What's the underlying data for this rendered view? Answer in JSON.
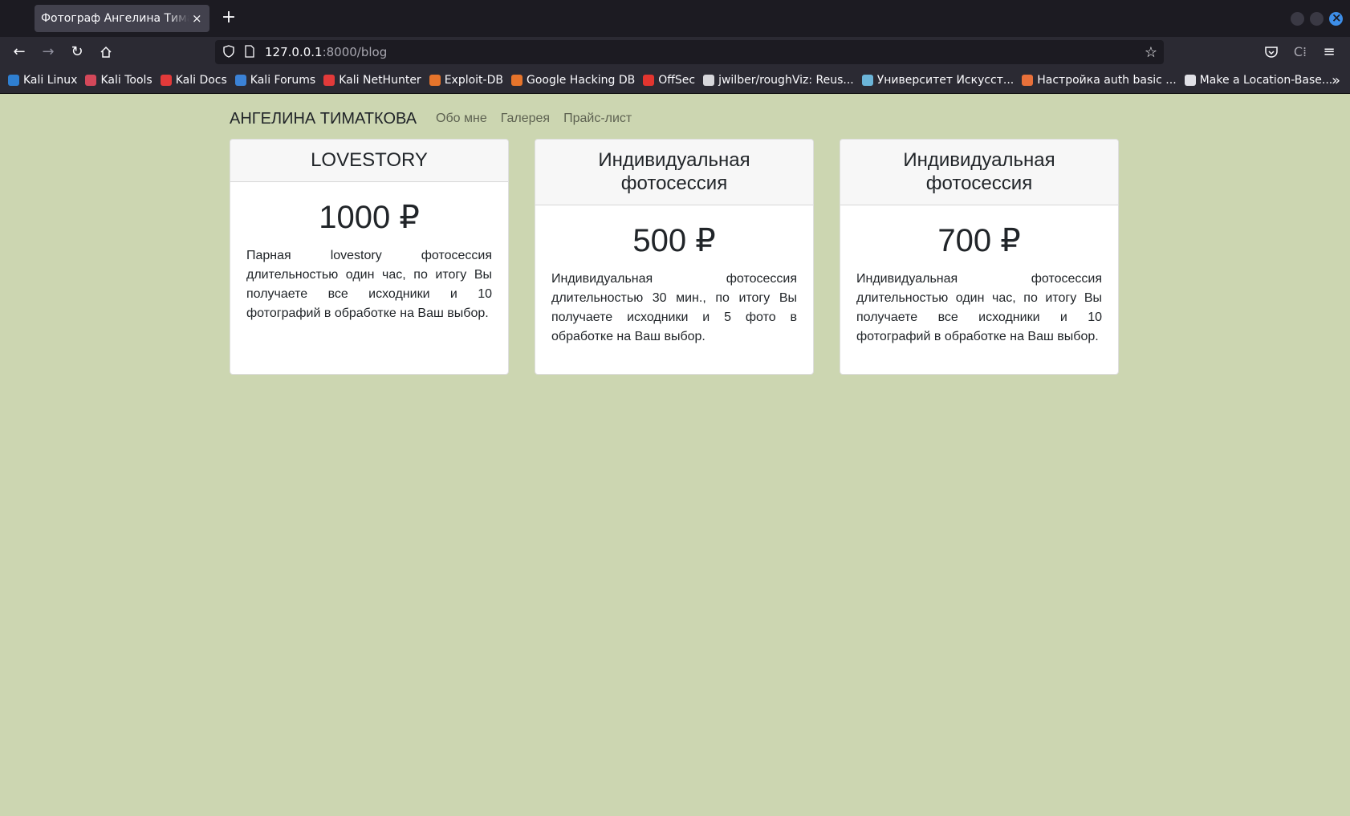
{
  "browser": {
    "tab_title": "Фотограф Ангелина Тиматкова",
    "tab_close": "×",
    "new_tab": "+",
    "url_host": "127.0.0.1",
    "url_path": ":8000/blog",
    "bookmarks": [
      {
        "label": "Kali Linux",
        "color": "#2f7fd1"
      },
      {
        "label": "Kali Tools",
        "color": "#d4485a"
      },
      {
        "label": "Kali Docs",
        "color": "#e23a3a"
      },
      {
        "label": "Kali Forums",
        "color": "#3b82d6"
      },
      {
        "label": "Kali NetHunter",
        "color": "#e23a3a"
      },
      {
        "label": "Exploit-DB",
        "color": "#e6742b"
      },
      {
        "label": "Google Hacking DB",
        "color": "#e6742b"
      },
      {
        "label": "OffSec",
        "color": "#e2352f"
      },
      {
        "label": "jwilber/roughViz: Reus...",
        "color": "#d7d7db"
      },
      {
        "label": "Университет Искусст...",
        "color": "#6bb4d8"
      },
      {
        "label": "Настройка auth basic ...",
        "color": "#e8703a"
      },
      {
        "label": "Make a Location-Base...",
        "color": "#e0e0e6"
      }
    ],
    "bookmarks_overflow": "»"
  },
  "site": {
    "brand": "АНГЕЛИНА ТИМАТКОВА",
    "nav": [
      "Обо мне",
      "Галерея",
      "Прайс-лист"
    ]
  },
  "cards": [
    {
      "title": "LOVESTORY",
      "price": "1000 ₽",
      "description": "Парная lovestory фотосессия длительностью один час, по итогу Вы получаете все исходники и 10 фотографий в обработке на Ваш выбор."
    },
    {
      "title": "Индивидуальная фотосессия",
      "price": "500 ₽",
      "description": "Индивидуальная фотосессия длительностью 30 мин., по итогу Вы получаете исходники и 5 фото в обработке на Ваш выбор."
    },
    {
      "title": "Индивидуальная фотосессия",
      "price": "700 ₽",
      "description": "Индивидуальная фотосессия длительностью один час, по итогу Вы получаете все исходники и 10 фотографий в обработке на Ваш выбор."
    }
  ],
  "colors": {
    "page_background": "#ccd6b1",
    "card_header": "#f7f7f7",
    "text": "#212529"
  }
}
